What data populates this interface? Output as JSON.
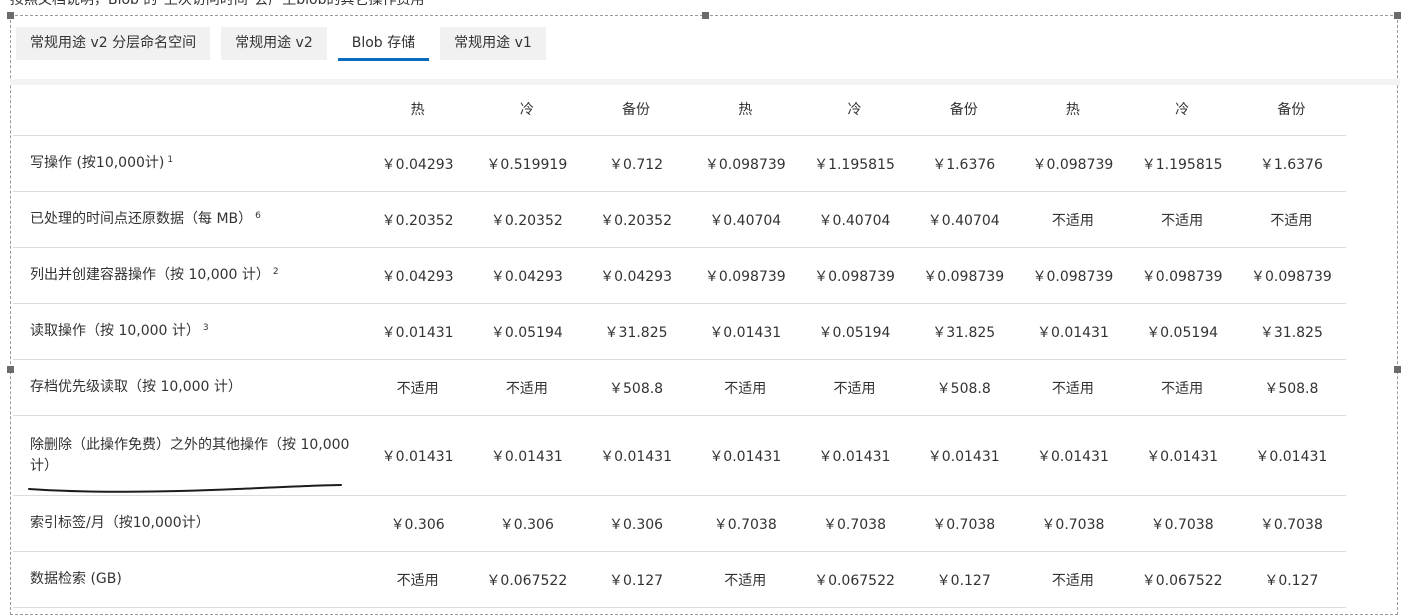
{
  "caption": "按照文档说明，Blob 的\"上次访问时间\"会产生blob的其它操作费用",
  "tabs": [
    {
      "label": "常规用途 v2 分层命名空间",
      "active": false
    },
    {
      "label": "常规用途 v2",
      "active": false
    },
    {
      "label": "Blob 存储",
      "active": true
    },
    {
      "label": "常规用途 v1",
      "active": false
    }
  ],
  "accent_color": "#0b6cbd",
  "columns": [
    "热",
    "冷",
    "备份",
    "热",
    "冷",
    "备份",
    "热",
    "冷",
    "备份"
  ],
  "rows": [
    {
      "label": "写操作 (按10,000计)",
      "note": "1",
      "values": [
        "￥0.04293",
        "￥0.519919",
        "￥0.712",
        "￥0.098739",
        "￥1.195815",
        "￥1.6376",
        "￥0.098739",
        "￥1.195815",
        "￥1.6376"
      ]
    },
    {
      "label": "已处理的时间点还原数据（每 MB）",
      "note": "6",
      "values": [
        "￥0.20352",
        "￥0.20352",
        "￥0.20352",
        "￥0.40704",
        "￥0.40704",
        "￥0.40704",
        "不适用",
        "不适用",
        "不适用"
      ]
    },
    {
      "label": "列出并创建容器操作（按 10,000 计）",
      "note": "2",
      "values": [
        "￥0.04293",
        "￥0.04293",
        "￥0.04293",
        "￥0.098739",
        "￥0.098739",
        "￥0.098739",
        "￥0.098739",
        "￥0.098739",
        "￥0.098739"
      ]
    },
    {
      "label": "读取操作（按 10,000 计）",
      "note": "3",
      "values": [
        "￥0.01431",
        "￥0.05194",
        "￥31.825",
        "￥0.01431",
        "￥0.05194",
        "￥31.825",
        "￥0.01431",
        "￥0.05194",
        "￥31.825"
      ]
    },
    {
      "label": "存档优先级读取（按 10,000 计）",
      "note": "",
      "values": [
        "不适用",
        "不适用",
        "￥508.8",
        "不适用",
        "不适用",
        "￥508.8",
        "不适用",
        "不适用",
        "￥508.8"
      ]
    },
    {
      "label": "除删除（此操作免费）之外的其他操作（按 10,000计）",
      "note": "",
      "values": [
        "￥0.01431",
        "￥0.01431",
        "￥0.01431",
        "￥0.01431",
        "￥0.01431",
        "￥0.01431",
        "￥0.01431",
        "￥0.01431",
        "￥0.01431"
      ]
    },
    {
      "label": "索引标签/月（按10,000计）",
      "note": "",
      "values": [
        "￥0.306",
        "￥0.306",
        "￥0.306",
        "￥0.7038",
        "￥0.7038",
        "￥0.7038",
        "￥0.7038",
        "￥0.7038",
        "￥0.7038"
      ]
    },
    {
      "label": "数据检索 (GB)",
      "note": "",
      "values": [
        "不适用",
        "￥0.067522",
        "￥0.127",
        "不适用",
        "￥0.067522",
        "￥0.127",
        "不适用",
        "￥0.067522",
        "￥0.127"
      ]
    }
  ]
}
